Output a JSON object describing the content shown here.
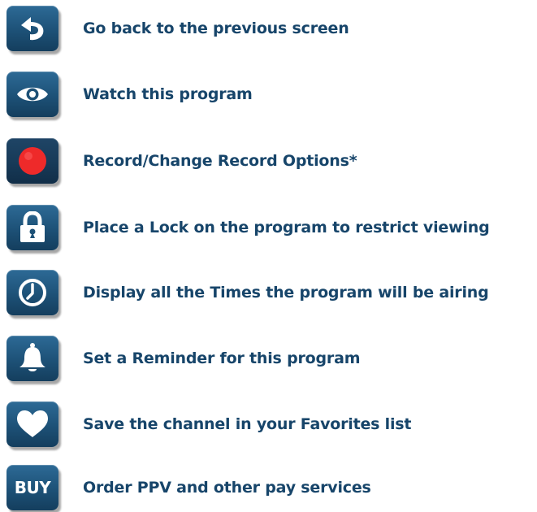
{
  "items": [
    {
      "id": "back",
      "icon": "back-arrow-icon",
      "label": "Go back to the previous screen"
    },
    {
      "id": "watch",
      "icon": "eye-icon",
      "label": "Watch this program"
    },
    {
      "id": "record",
      "icon": "record-dot-icon",
      "label": "Record/Change Record Options*"
    },
    {
      "id": "lock",
      "icon": "lock-icon",
      "label": "Place a Lock on the program to restrict viewing"
    },
    {
      "id": "times",
      "icon": "clock-icon",
      "label": "Display all the Times the program will be airing"
    },
    {
      "id": "reminder",
      "icon": "bell-icon",
      "label": "Set a Reminder for this program"
    },
    {
      "id": "favorite",
      "icon": "heart-icon",
      "label": "Save the channel in your Favorites list"
    },
    {
      "id": "buy",
      "icon": "buy-text-icon",
      "icon_text": "BUY",
      "label": "Order PPV and other pay services"
    }
  ],
  "colors": {
    "button_blue": "#1d5177",
    "label_blue": "#17456a",
    "record_red": "#ee2a2a"
  }
}
